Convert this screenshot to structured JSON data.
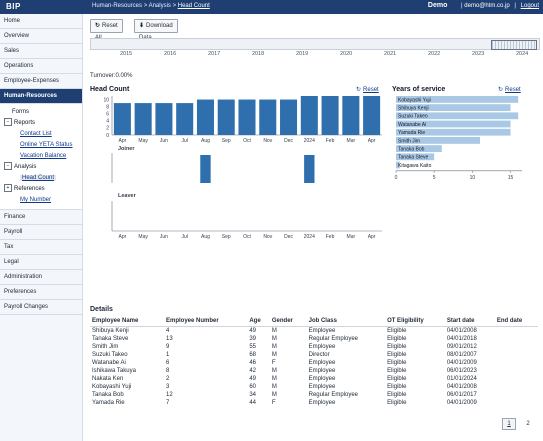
{
  "header": {
    "brand": "BIP",
    "breadcrumb": [
      "Human-Resources",
      "Analysis",
      "Head Count"
    ],
    "breadcrumb_sep": ">",
    "demo": "Demo",
    "email": "demo@htm.co.jp",
    "logout": "Logout",
    "sep": "|"
  },
  "sidebar": {
    "items": [
      {
        "label": "Home"
      },
      {
        "label": "Overview"
      },
      {
        "label": "Sales"
      },
      {
        "label": "Operations"
      },
      {
        "label": "Employee-Expenses"
      },
      {
        "label": "Human-Resources"
      }
    ],
    "hr_sub": {
      "forms": "Forms",
      "reports": "Reports",
      "reports_children": [
        "Contact List",
        "Online YETA Status",
        "Vacation Balance"
      ],
      "analysis": "Analysis",
      "analysis_children": [
        "Head Count"
      ],
      "references": "References",
      "references_children": [
        "My Number"
      ],
      "toggle_minus": "−",
      "toggle_plus": "+"
    },
    "items_after": [
      {
        "label": "Finance"
      },
      {
        "label": "Payroll"
      },
      {
        "label": "Tax"
      },
      {
        "label": "Legal"
      },
      {
        "label": "Administration"
      },
      {
        "label": "Preferences"
      },
      {
        "label": "Payroll Changes"
      }
    ]
  },
  "toolbar": {
    "reset_all": "Reset All",
    "download": "Download Data"
  },
  "timeline": {
    "years": [
      "2015",
      "2016",
      "2017",
      "2018",
      "2019",
      "2020",
      "2021",
      "2022",
      "2023",
      "2024"
    ]
  },
  "turnover": "Turnover:0.00%",
  "headcount_panel": {
    "title": "Head Count",
    "reset": "Reset",
    "joiner": "Joiner",
    "leaver": "Leaver"
  },
  "yos_panel": {
    "title": "Years of service",
    "reset": "Reset"
  },
  "chart_data": [
    {
      "type": "bar",
      "title": "Head Count",
      "categories": [
        "Apr",
        "May",
        "Jun",
        "Jul",
        "Aug",
        "Sep",
        "Oct",
        "Nov",
        "Dec",
        "2024",
        "Feb",
        "Mar",
        "Apr"
      ],
      "values": [
        9,
        9,
        9,
        9,
        10,
        10,
        10,
        10,
        10,
        11,
        11,
        11,
        11
      ],
      "yticks": [
        "0",
        "2",
        "4",
        "6",
        "8",
        "10"
      ],
      "ylim": [
        0,
        11
      ]
    },
    {
      "type": "bar",
      "title": "Joiner",
      "categories": [
        "Apr",
        "May",
        "Jun",
        "Jul",
        "Aug",
        "Sep",
        "Oct",
        "Nov",
        "Dec",
        "2024",
        "Feb",
        "Mar",
        "Apr"
      ],
      "values": [
        0,
        0,
        0,
        0,
        1,
        0,
        0,
        0,
        0,
        1,
        0,
        0,
        0
      ],
      "ylim": [
        0,
        1
      ]
    },
    {
      "type": "bar",
      "title": "Leaver",
      "categories": [
        "Apr",
        "May",
        "Jun",
        "Jul",
        "Aug",
        "Sep",
        "Oct",
        "Nov",
        "Dec",
        "2024",
        "Feb",
        "Mar",
        "Apr"
      ],
      "values": [
        0,
        0,
        0,
        0,
        0,
        0,
        0,
        0,
        0,
        0,
        0,
        0,
        0
      ],
      "ylim": [
        0,
        1
      ]
    },
    {
      "type": "bar",
      "orientation": "horizontal",
      "title": "Years of service",
      "categories": [
        "Kobayashi Yuji",
        "Shibuya Kenji",
        "Suzuki Takeo",
        "Watanabe Ai",
        "Yamada Rie",
        "Smith Jim",
        "Tanaka Bob",
        "Tanaka Steve",
        "Kitagawa Kaito"
      ],
      "values": [
        16,
        15,
        16,
        15,
        15,
        11,
        6,
        5,
        0.5
      ],
      "xticks": [
        "0",
        "5",
        "10",
        "15"
      ],
      "xlim": [
        0,
        16.5
      ]
    }
  ],
  "details": {
    "title": "Details",
    "columns": [
      "Employee Name",
      "Employee Number",
      "Age",
      "Gender",
      "Job Class",
      "OT Eligibility",
      "Start date",
      "End date"
    ],
    "rows": [
      [
        "Shibuya Kenji",
        "4",
        "49",
        "M",
        "Employee",
        "Eligible",
        "04/01/2008",
        ""
      ],
      [
        "Tanaka Steve",
        "13",
        "39",
        "M",
        "Regular Employee",
        "Eligible",
        "04/01/2018",
        ""
      ],
      [
        "Smith Jim",
        "9",
        "55",
        "M",
        "Employee",
        "Eligible",
        "09/01/2012",
        ""
      ],
      [
        "Suzuki Takeo",
        "1",
        "68",
        "M",
        "Director",
        "Eligible",
        "08/01/2007",
        ""
      ],
      [
        "Watanabe Ai",
        "6",
        "46",
        "F",
        "Employee",
        "Eligible",
        "04/01/2009",
        ""
      ],
      [
        "Ishikawa Takuya",
        "8",
        "42",
        "M",
        "Employee",
        "Eligible",
        "06/01/2023",
        ""
      ],
      [
        "Nakata Ken",
        "2",
        "49",
        "M",
        "Employee",
        "Eligible",
        "01/01/2024",
        ""
      ],
      [
        "Kobayashi Yuji",
        "3",
        "60",
        "M",
        "Employee",
        "Eligible",
        "04/01/2008",
        ""
      ],
      [
        "Tanaka Bob",
        "12",
        "34",
        "M",
        "Regular Employee",
        "Eligible",
        "06/01/2017",
        ""
      ],
      [
        "Yamada Rie",
        "7",
        "44",
        "F",
        "Employee",
        "Eligible",
        "04/01/2009",
        ""
      ]
    ]
  },
  "pager": [
    "1",
    "2"
  ],
  "colors": {
    "header_bg": "#1f3f73",
    "bar_primary": "#2f6fad",
    "bar_secondary": "#a9c8e6"
  }
}
